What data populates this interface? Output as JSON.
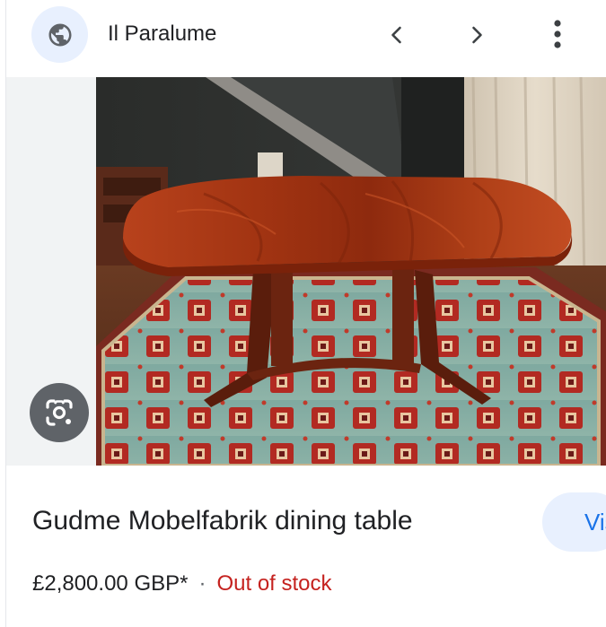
{
  "header": {
    "site_name": "Il Paralume",
    "site_icon": "globe-icon",
    "prev_icon": "chevron-left-icon",
    "next_icon": "chevron-right-icon",
    "more_icon": "more-vert-icon"
  },
  "media": {
    "lens_icon": "google-lens-icon"
  },
  "product": {
    "title": "Gudme Mobelfabrik dining table",
    "price": "£2,800.00 GBP*",
    "separator": "·",
    "availability": "Out of stock",
    "visit_label": "Visit"
  },
  "colors": {
    "accent": "#1a73e8",
    "accent_bg": "#e8f0fe",
    "out_of_stock": "#c5221f",
    "text": "#202124",
    "secondary": "#5f6368"
  }
}
